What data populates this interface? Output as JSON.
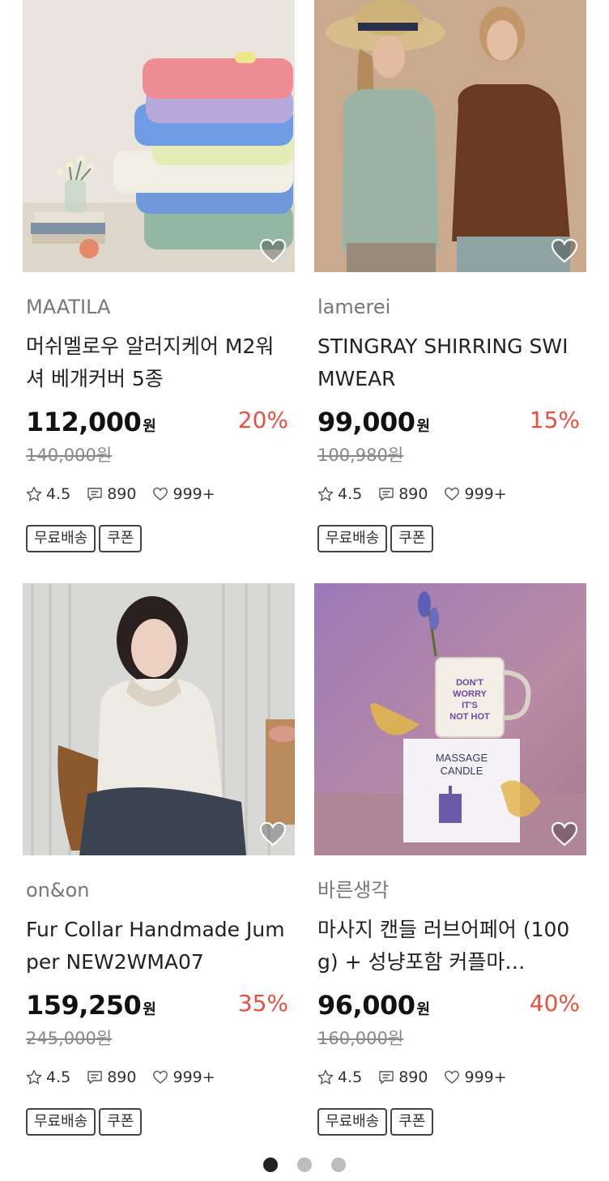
{
  "products": [
    {
      "brand": "MAATILA",
      "name": "머쉬멜로우 알러지케어 M2워셔 베개커버 5종",
      "price": "112,000",
      "currency": "원",
      "discount": "20%",
      "original_price": "140,000원",
      "rating": "4.5",
      "reviews": "890",
      "likes": "999+",
      "tags": [
        "무료배송",
        "쿠폰"
      ],
      "image": "pillow-stack-photo"
    },
    {
      "brand": "lamerei",
      "name": "STINGRAY SHIRRING SWIMWEAR",
      "price": "99,000",
      "currency": "원",
      "discount": "15%",
      "original_price": "100,980원",
      "rating": "4.5",
      "reviews": "890",
      "likes": "999+",
      "tags": [
        "무료배송",
        "쿠폰"
      ],
      "image": "two-models-photo"
    },
    {
      "brand": "on&on",
      "name": "Fur Collar Handmade Jumper NEW2WMA07",
      "price": "159,250",
      "currency": "원",
      "discount": "35%",
      "original_price": "245,000원",
      "rating": "4.5",
      "reviews": "890",
      "likes": "999+",
      "tags": [
        "무료배송",
        "쿠폰"
      ],
      "image": "jacket-model-photo"
    },
    {
      "brand": "바른생각",
      "name": "마사지 캔들 러브어페어 (100g) + 성냥포함 커플마…",
      "price": "96,000",
      "currency": "원",
      "discount": "40%",
      "original_price": "160,000원",
      "rating": "4.5",
      "reviews": "890",
      "likes": "999+",
      "tags": [
        "무료배송",
        "쿠폰"
      ],
      "image": "massage-candle-photo",
      "image_text": {
        "mug_line1": "DON'T",
        "mug_line2": "WORRY",
        "mug_line3": "IT'S",
        "mug_line4": "NOT HOT",
        "box_line1": "MASSAGE",
        "box_line2": "CANDLE"
      }
    }
  ],
  "pagination": {
    "pages": 3,
    "active": 0
  },
  "colors": {
    "discount": "#e8513f",
    "text": "#222222",
    "muted": "#888888"
  }
}
